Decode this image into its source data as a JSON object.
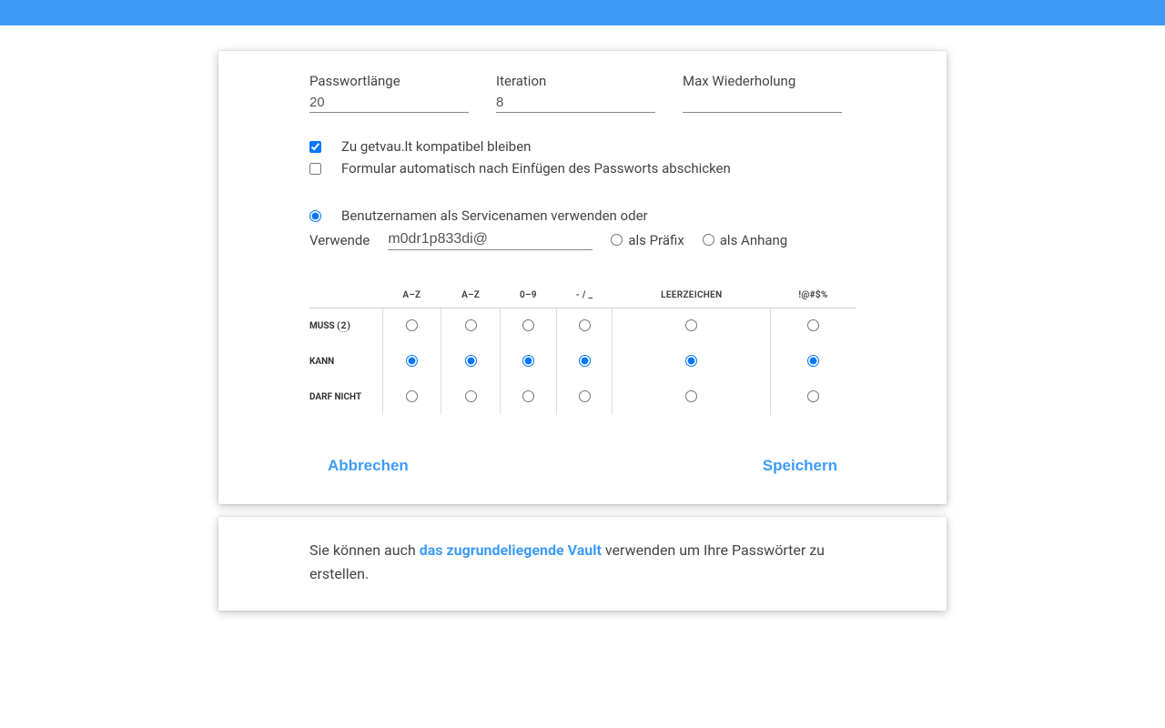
{
  "fields": {
    "pwlen_label": "Passwortlänge",
    "pwlen_value": "20",
    "iter_label": "Iteration",
    "iter_value": "8",
    "maxrep_label": "Max Wiederholung",
    "maxrep_value": ""
  },
  "checkboxes": {
    "compatible_label": "Zu getvau.lt kompatibel bleiben",
    "autosubmit_label": "Formular automatisch nach Einfügen des Passworts abschicken"
  },
  "servicename": {
    "use_username_label": "Benutzernamen als Servicenamen verwenden oder",
    "verwende_label": "Verwende",
    "verwende_value": "m0dr1p833di@",
    "prefix_label": "als Präfix",
    "suffix_label": "als Anhang"
  },
  "char_table": {
    "columns": [
      "a–z",
      "A–Z",
      "0–9",
      "- / _",
      "LEERZEICHEN",
      "!@#$%"
    ],
    "rows": {
      "must_label": "MUSS",
      "must_count": "2",
      "may_label": "KANN",
      "mustnot_label": "DARF NICHT"
    }
  },
  "actions": {
    "cancel": "Abbrechen",
    "save": "Speichern"
  },
  "footer": {
    "text_before": "Sie können auch ",
    "link": "das zugrundeliegende Vault",
    "text_after": " verwenden um Ihre Passwörter zu erstellen."
  }
}
